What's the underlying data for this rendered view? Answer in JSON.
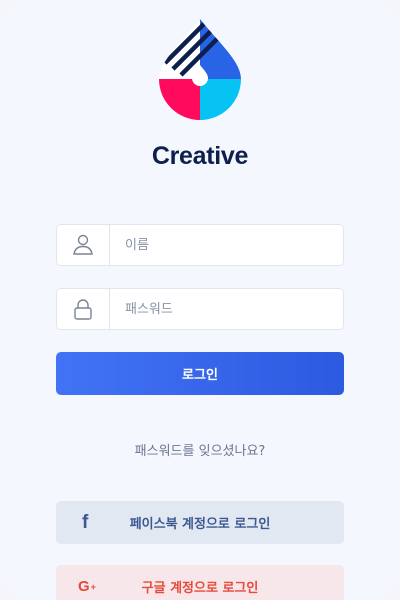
{
  "app": {
    "title": "Creative"
  },
  "form": {
    "name_placeholder": "이름",
    "password_placeholder": "패스워드",
    "login_label": "로그인",
    "forgot_label": "패스워드를 잊으셨나요?"
  },
  "social": {
    "facebook_label": "페이스북 계정으로 로그인",
    "google_label": "구글 계정으로 로그인",
    "facebook_icon": "f",
    "google_icon": "G"
  },
  "icons": {
    "name": "user-icon",
    "password": "lock-icon",
    "facebook": "facebook-icon",
    "google": "google-plus-icon"
  },
  "colors": {
    "primary": "#3366ee",
    "title": "#0e1f4e",
    "facebook": "#3d5992",
    "google": "#e64a3b",
    "logo_blue": "#2a64e6",
    "logo_pink": "#ff0a5c",
    "logo_cyan": "#06c3f3"
  }
}
